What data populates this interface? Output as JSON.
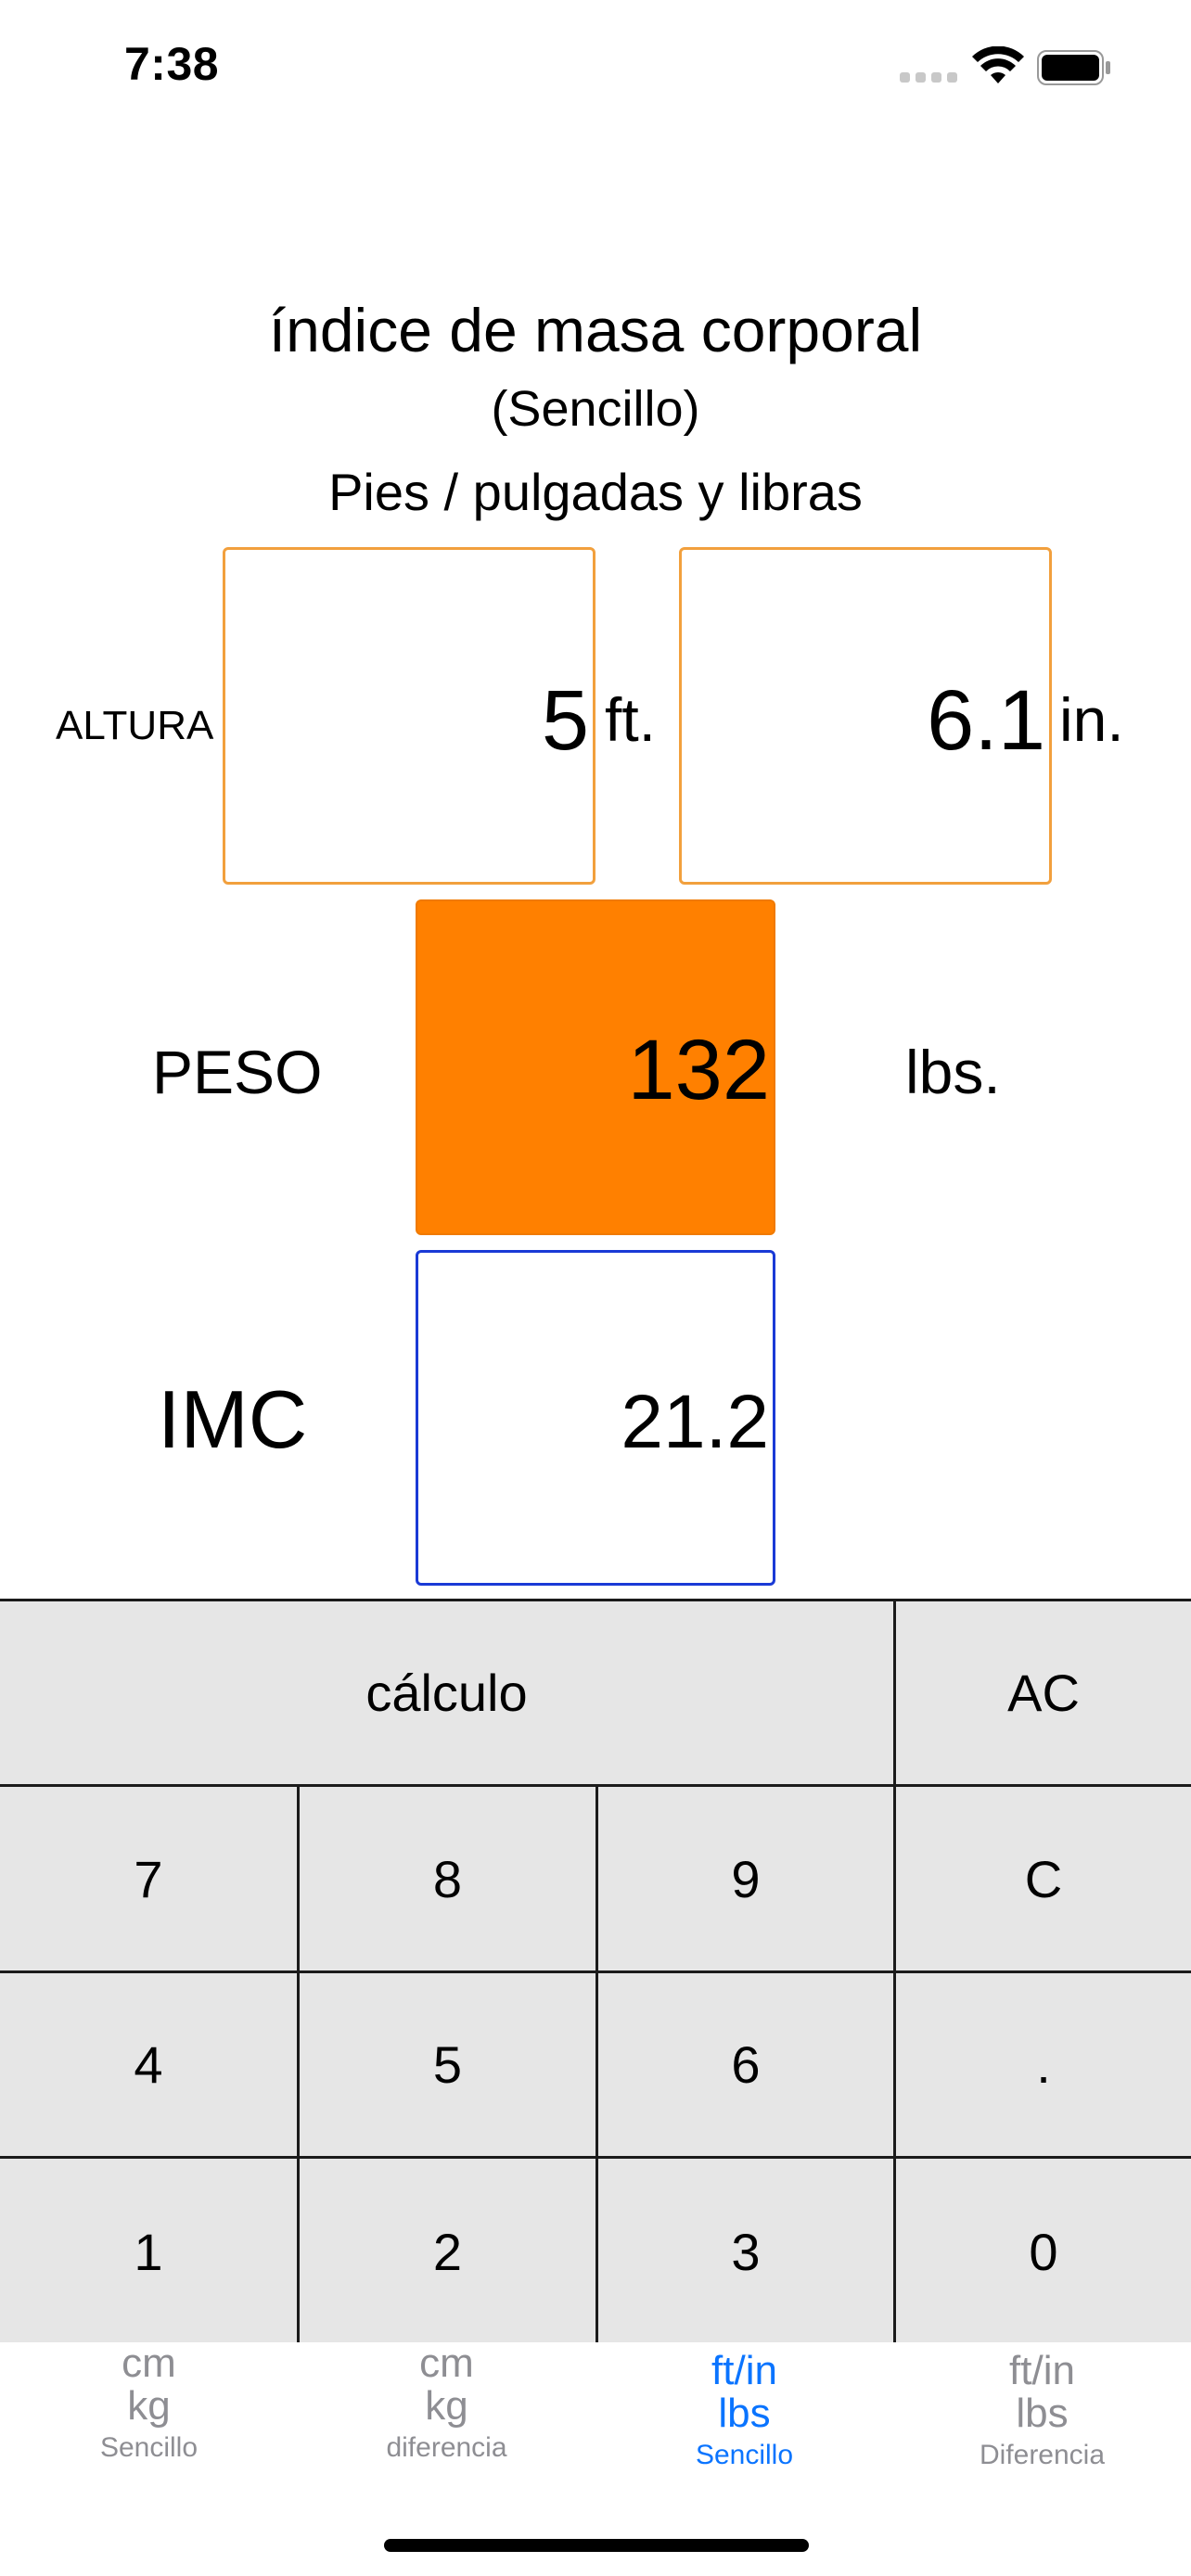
{
  "status_bar": {
    "time": "7:38"
  },
  "header": {
    "title": "índice de masa corporal",
    "subtitle": "(Sencillo)",
    "units_line": "Pies / pulgadas y libras"
  },
  "height": {
    "label": "ALTURA",
    "feet_value": "5",
    "feet_unit": "ft.",
    "inches_value": "6.1",
    "inches_unit": "in."
  },
  "weight": {
    "label": "PESO",
    "value": "132",
    "unit": "lbs."
  },
  "bmi": {
    "label": "IMC",
    "value": "21.2"
  },
  "keypad": {
    "calc": "cálculo",
    "ac": "AC",
    "k7": "7",
    "k8": "8",
    "k9": "9",
    "c": "C",
    "k4": "4",
    "k5": "5",
    "k6": "6",
    "dot": ".",
    "k1": "1",
    "k2": "2",
    "k3": "3",
    "k0": "0"
  },
  "tabs": [
    {
      "line1": "cm",
      "line2": "kg",
      "label": "Sencillo"
    },
    {
      "line1": "cm",
      "line2": "kg",
      "label": "diferencia"
    },
    {
      "line1": "ft/in",
      "line2": "lbs",
      "label": "Sencillo"
    },
    {
      "line1": "ft/in",
      "line2": "lbs",
      "label": "Diferencia"
    }
  ],
  "colors": {
    "accent_orange": "#ff8000",
    "outline_orange": "#f2a03d",
    "outline_blue": "#1a3ad6",
    "tab_active": "#0a74ff",
    "tab_inactive": "#8e8e93",
    "keypad_bg": "#e6e6e6"
  },
  "icons": [
    "cellular-signal-icon",
    "wifi-icon",
    "battery-icon"
  ]
}
